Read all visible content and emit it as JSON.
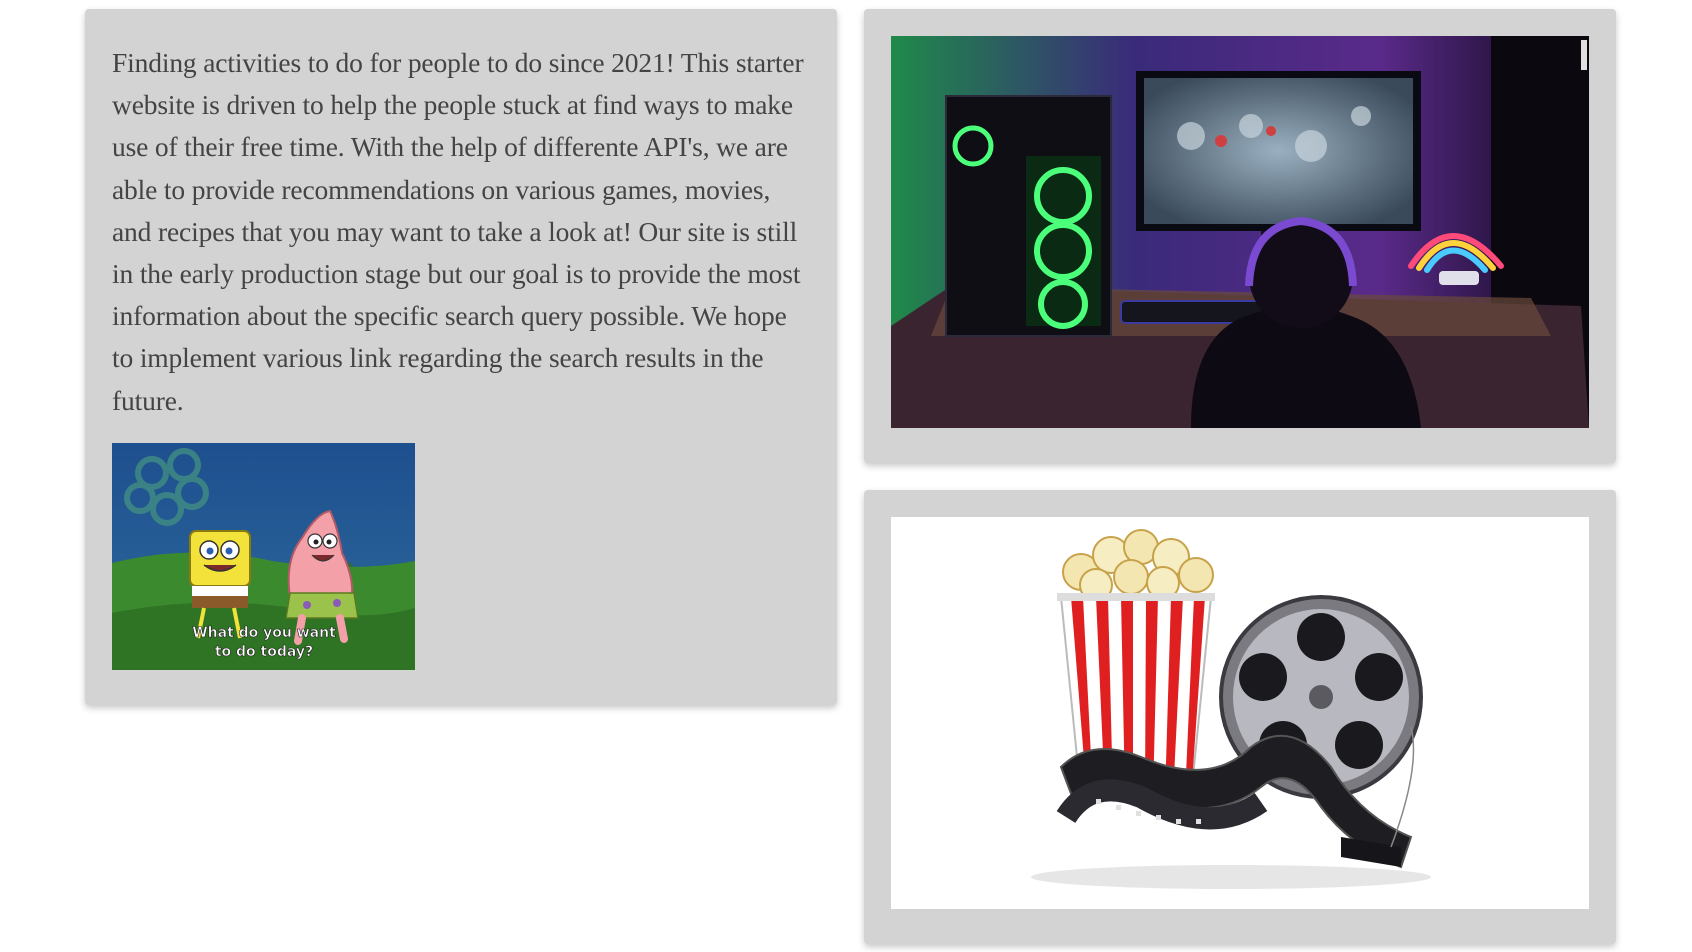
{
  "about": {
    "text": "Finding activities to do for people to do since 2021! This starter website is driven to help the people stuck at find ways to make use of their free time. With the help of differente API's, we are able to provide recommendations on various games, movies, and recipes that you may want to take a look at! Our site is still in the early production stage but our goal is to provide the most information about the specific search query possible. We hope to implement various link regarding the search results in the future."
  },
  "gif": {
    "caption_line1": "What do you want",
    "caption_line2": "to do today?"
  },
  "colors": {
    "card_background": "#d3d3d3",
    "text": "#444444",
    "page_background": "#ffffff"
  }
}
